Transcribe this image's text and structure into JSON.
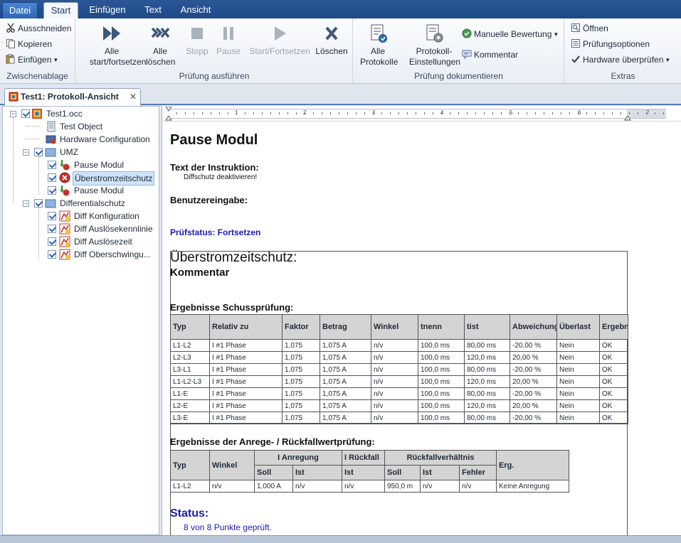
{
  "ribbon_tabs": [
    {
      "label": "Datei"
    },
    {
      "label": "Start"
    },
    {
      "label": "Einfügen"
    },
    {
      "label": "Text"
    },
    {
      "label": "Ansicht"
    }
  ],
  "clipboard": {
    "cut": "Ausschneiden",
    "copy": "Kopieren",
    "paste": "Einfügen",
    "group": "Zwischenablage"
  },
  "run": {
    "all_start": "Alle start/fortsetzen",
    "all_clear": "Alle löschen",
    "stop": "Stopp",
    "pause": "Pause",
    "start_continue": "Start/Fortsetzen",
    "clear": "Löschen",
    "group": "Prüfung ausführen"
  },
  "document": {
    "all_reports": "Alle Protokolle",
    "report_settings": "Protokoll-Einstellungen",
    "manual_rating": "Manuelle Bewertung",
    "comment": "Kommentar",
    "group": "Prüfung dokumentieren"
  },
  "extras": {
    "open": "Öffnen",
    "options": "Prüfungsoptionen",
    "check_hw": "Hardware überprüfen",
    "group": "Extras"
  },
  "doc_tab": {
    "label": "Test1: Protokoll-Ansicht",
    "close": "✕"
  },
  "tree": [
    {
      "label": "Test1.occ",
      "icon": "test-file-icon"
    },
    {
      "label": "Test Object",
      "icon": "test-object-icon"
    },
    {
      "label": "Hardware Configuration",
      "icon": "hardware-icon"
    },
    {
      "label": "UMZ",
      "icon": "folder-icon"
    },
    {
      "label": "Pause Modul",
      "icon": "pause-module-icon"
    },
    {
      "label": "Überstromzeitschutz",
      "icon": "overcurrent-icon"
    },
    {
      "label": "Pause Modul",
      "icon": "pause-module-icon"
    },
    {
      "label": "Differentialschutz",
      "icon": "folder-icon"
    },
    {
      "label": "Diff Konfiguration",
      "icon": "diff-icon"
    },
    {
      "label": "Diff Auslösekennlinie",
      "icon": "diff-icon"
    },
    {
      "label": "Diff Auslösezeit",
      "icon": "diff-icon"
    },
    {
      "label": "Diff Oberschwingu...",
      "icon": "diff-icon"
    }
  ],
  "ruler_numbers": [
    "1",
    "2",
    "3",
    "4",
    "5",
    "6",
    "7"
  ],
  "report": {
    "title": "Pause Modul",
    "instruction_heading": "Text der Instruktion:",
    "instruction_text": "Diffschutz deaktivieren!",
    "user_input": "Benutzereingabe:",
    "test_status": "Prüfstatus: Fortsetzen",
    "section_title": "Überstromzeitschutz:",
    "comment_heading": "Kommentar",
    "shot_heading": "Ergebnisse Schussprüfung:",
    "shot_columns": [
      "Typ",
      "Relativ zu",
      "Faktor",
      "Betrag",
      "Winkel",
      "tnenn",
      "tist",
      "Abweichung",
      "Überlast",
      "Ergebnis"
    ],
    "shot_rows": [
      [
        "L1-L2",
        "I #1 Phase",
        "1,075",
        "1,075  A",
        "n/v",
        "100,0 ms",
        "80,00 ms",
        "-20,00  %",
        "Nein",
        "OK"
      ],
      [
        "L2-L3",
        "I #1 Phase",
        "1,075",
        "1,075  A",
        "n/v",
        "100,0 ms",
        "120,0 ms",
        "20,00  %",
        "Nein",
        "OK"
      ],
      [
        "L3-L1",
        "I #1 Phase",
        "1,075",
        "1,075  A",
        "n/v",
        "100,0 ms",
        "80,00 ms",
        "-20,00  %",
        "Nein",
        "OK"
      ],
      [
        "L1-L2-L3",
        "I #1 Phase",
        "1,075",
        "1,075  A",
        "n/v",
        "100,0 ms",
        "120,0 ms",
        "20,00  %",
        "Nein",
        "OK"
      ],
      [
        "L1-E",
        "I #1 Phase",
        "1,075",
        "1,075  A",
        "n/v",
        "100,0 ms",
        "80,00 ms",
        "-20,00  %",
        "Nein",
        "OK"
      ],
      [
        "L2-E",
        "I #1 Phase",
        "1,075",
        "1,075  A",
        "n/v",
        "100,0 ms",
        "120,0 ms",
        "20,00  %",
        "Nein",
        "OK"
      ],
      [
        "L3-E",
        "I #1 Phase",
        "1,075",
        "1,075  A",
        "n/v",
        "100,0 ms",
        "80,00 ms",
        "-20,00  %",
        "Nein",
        "OK"
      ]
    ],
    "pickup_heading": "Ergebnisse der Anrege- / Rückfallwertprüfung:",
    "pickup_head": {
      "typ": "Typ",
      "winkel": "Winkel",
      "anregung": "I Anregung",
      "rueckfall": "I Rückfall",
      "verhaeltnis": "Rückfallverhältnis",
      "erg": "Erg.",
      "soll": "Soll",
      "ist": "Ist",
      "fehler": "Fehler"
    },
    "pickup_row": [
      "L1-L2",
      "n/v",
      "1,000  A",
      "n/v",
      "n/v",
      "950,0 m",
      "n/v",
      "n/v",
      "Keine Anregung"
    ],
    "status_heading": "Status:",
    "status_text": "8 von 8 Punkte geprüft."
  }
}
